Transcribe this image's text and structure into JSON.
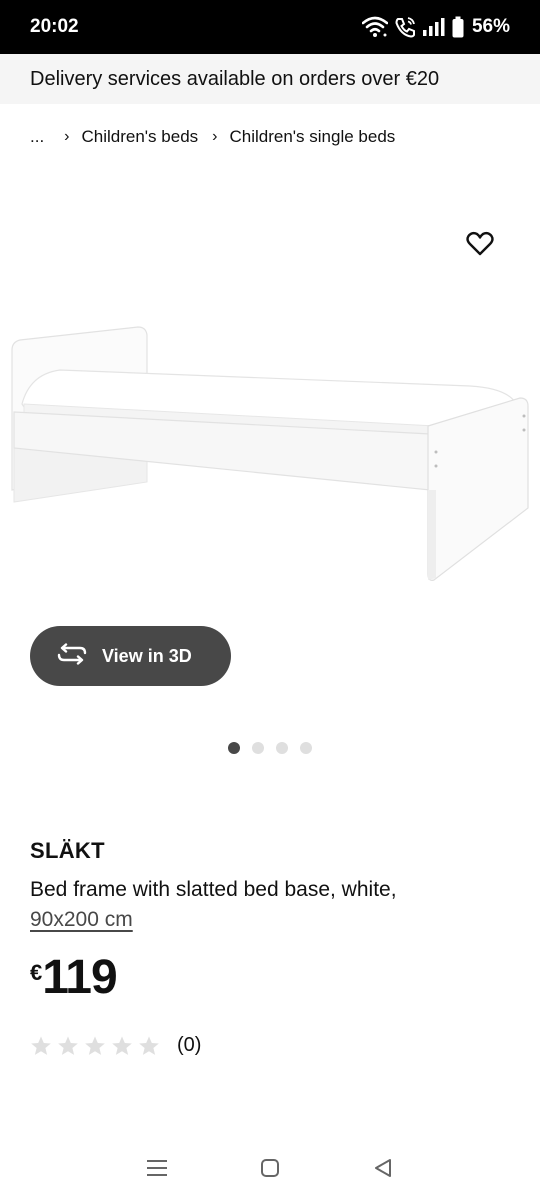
{
  "status_bar": {
    "time": "20:02",
    "battery": "56%",
    "icons": [
      "wifi-icon",
      "wifi-call-icon",
      "signal-icon",
      "battery-icon"
    ]
  },
  "banner": {
    "text": "Delivery services available on orders over €20"
  },
  "breadcrumb": {
    "ellipsis": "...",
    "items": [
      "Children's beds",
      "Children's single beds"
    ]
  },
  "product_image": {
    "description_icon": "bed-image",
    "favorite_icon": "heart-icon"
  },
  "view3d": {
    "label": "View in 3D",
    "icon": "rotate-3d-icon"
  },
  "carousel": {
    "count": 4,
    "active_index": 0
  },
  "product": {
    "name": "SLÄKT",
    "description": "Bed frame with slatted bed base, white,",
    "size": "90x200 cm",
    "currency": "€",
    "price": "119",
    "rating_stars": 0,
    "rating_max": 5,
    "rating_count": "(0)"
  },
  "nav_bar": {
    "icons": [
      "recent-apps-icon",
      "home-icon",
      "back-icon"
    ]
  },
  "colors": {
    "dark_button": "#484848",
    "banner_bg": "#f5f5f5",
    "status_bar_bg": "#000000",
    "star_empty": "#dfdfdf"
  }
}
